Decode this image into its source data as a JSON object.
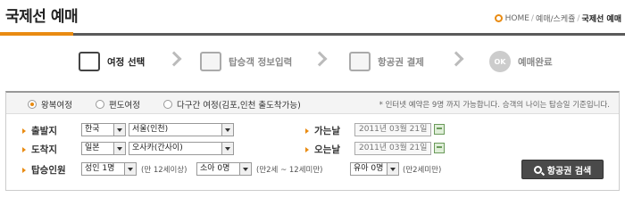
{
  "header": {
    "title": "국제선 예매",
    "breadcrumb": {
      "home": "HOME",
      "sep1": "/",
      "level1": "예매/스케쥴",
      "sep2": "/",
      "current": "국제선 예매"
    }
  },
  "steps": [
    {
      "label": "여정 선택",
      "icon": "route-sign-icon",
      "active": true
    },
    {
      "label": "탑승객 정보입력",
      "icon": "monitor-icon",
      "active": false
    },
    {
      "label": "항공권 결제",
      "icon": "ticket-icon",
      "active": false
    },
    {
      "label": "예매완료",
      "icon": "ok-icon",
      "icon_text": "OK",
      "active": false
    }
  ],
  "trip_types": [
    {
      "label": "왕복여정",
      "selected": true
    },
    {
      "label": "편도여정",
      "selected": false
    },
    {
      "label": "다구간 여정(김포,인천 출도착가능)",
      "selected": false
    }
  ],
  "notice": "* 인터넷 예약은 9명 까지 가능합니다. 승객의 나이는 탑승일 기준입니다.",
  "departure": {
    "label": "출발지",
    "country": "한국",
    "city": "서울(인천)"
  },
  "arrival": {
    "label": "도착지",
    "country": "일본",
    "city": "오사카(간사이)"
  },
  "go_date": {
    "label": "가는날",
    "value": "2011년 03월 21일"
  },
  "return_date": {
    "label": "오는날",
    "value": "2011년 03월 21일"
  },
  "passengers": {
    "label": "탑승인원",
    "adult": "성인 1명",
    "adult_hint": "(만 12세이상)",
    "child": "소아 0명",
    "child_hint": "(만2세 ~ 12세미만)",
    "infant": "유아 0명",
    "infant_hint": "(만2세미만)"
  },
  "search_button": "항공권 검색",
  "colors": {
    "accent": "#e98b12",
    "button": "#4a4a4a"
  }
}
